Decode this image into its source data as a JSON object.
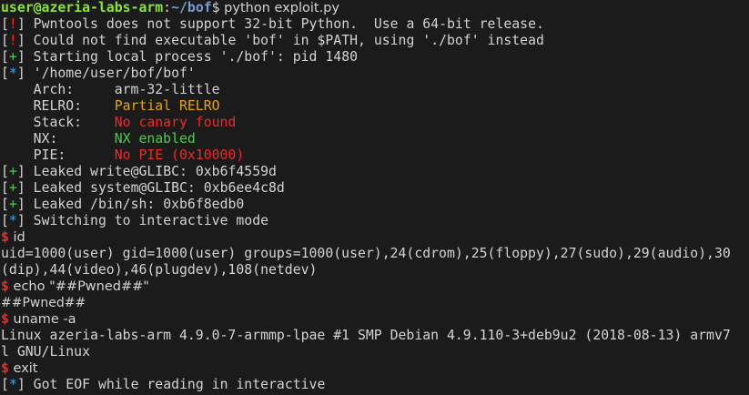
{
  "prompt": {
    "user_host": "user@azeria-labs-arm",
    "sep": ":",
    "path": "~/bof",
    "symbol": "$",
    "command": " python exploit.py"
  },
  "log": {
    "l1_tag_open": "[",
    "l1_tag": "!",
    "l1_tag_close": "]",
    "l1_text": " Pwntools does not support 32-bit Python.  Use a 64-bit release.",
    "l2_tag_open": "[",
    "l2_tag": "!",
    "l2_tag_close": "]",
    "l2_text": " Could not find executable 'bof' in $PATH, using './bof' instead",
    "l3_tag_open": "[",
    "l3_tag": "+",
    "l3_tag_close": "]",
    "l3_text": " Starting local process './bof': pid 1480",
    "l4_tag_open": "[",
    "l4_tag": "*",
    "l4_tag_close": "]",
    "l4_text": " '/home/user/bof/bof'"
  },
  "checksec": {
    "arch_label": "    Arch:     ",
    "arch_value": "arm-32-little",
    "relro_label": "    RELRO:    ",
    "relro_value": "Partial RELRO",
    "stack_label": "    Stack:    ",
    "stack_value": "No canary found",
    "nx_label": "    NX:       ",
    "nx_value": "NX enabled",
    "pie_label": "    PIE:      ",
    "pie_value": "No PIE (0x10000)"
  },
  "leaks": {
    "l1_tag": "+",
    "l1_text": " Leaked write@GLIBC: 0xb6f4559d",
    "l2_tag": "+",
    "l2_text": " Leaked system@GLIBC: 0xb6ee4c8d",
    "l3_tag": "+",
    "l3_text": " Leaked /bin/sh: 0xb6f8edb0",
    "l4_tag": "*",
    "l4_text": " Switching to interactive mode"
  },
  "session": {
    "ps": "$",
    "cmd_id": " id",
    "out_id_1": "uid=1000(user) gid=1000(user) groups=1000(user),24(cdrom),25(floppy),27(sudo),29(audio),30",
    "out_id_2": "(dip),44(video),46(plugdev),108(netdev)",
    "cmd_echo": " echo \"##Pwned##\"",
    "out_echo": "##Pwned##",
    "cmd_uname": " uname -a",
    "out_uname_1": "Linux azeria-labs-arm 4.9.0-7-armmp-lpae #1 SMP Debian 4.9.110-3+deb9u2 (2018-08-13) armv7",
    "out_uname_2": "l GNU/Linux",
    "cmd_exit": " exit",
    "eof_tag": "*",
    "eof_text": " Got EOF while reading in interactive"
  },
  "colors": {
    "background": "#1b1b1b",
    "text": "#d3d3d3",
    "red": "#ef2929",
    "green": "#4ec94e",
    "blue": "#4aa3df",
    "yellow": "#e5a50a"
  }
}
